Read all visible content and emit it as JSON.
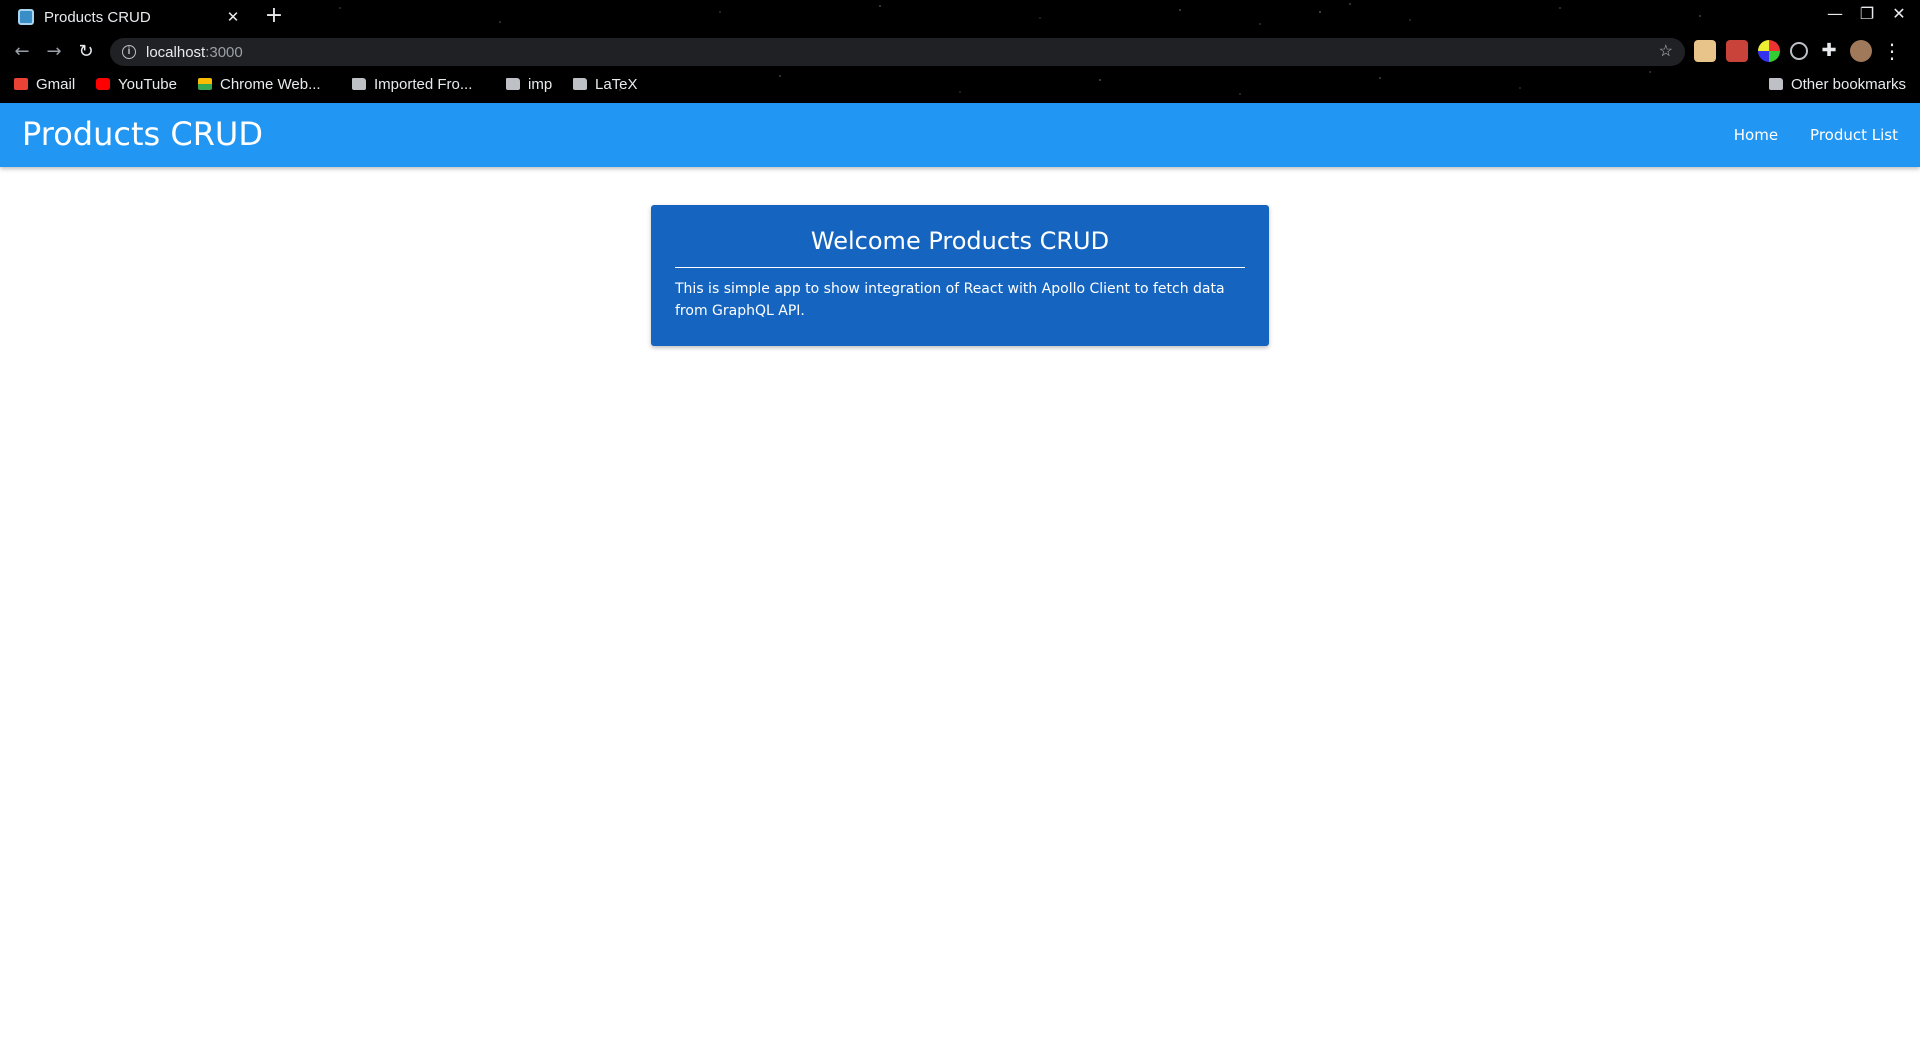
{
  "browser": {
    "tab": {
      "title": "Products CRUD",
      "close_glyph": "✕",
      "favicon": "react-icon"
    },
    "new_tab_glyph": "+",
    "window_controls": [
      "—",
      "❐",
      "✕"
    ],
    "nav": {
      "back_glyph": "←",
      "forward_glyph": "→",
      "reload_glyph": "↻"
    },
    "address": {
      "host": "localhost",
      "port": ":3000"
    },
    "bookmarks": [
      {
        "label": "Gmail",
        "icon": "gmail-icon"
      },
      {
        "label": "YouTube",
        "icon": "youtube-icon"
      },
      {
        "label": "Chrome Web...",
        "icon": "chrome-webstore-icon"
      },
      {
        "label": "Imported Fro...",
        "icon": "folder-icon"
      },
      {
        "label": "imp",
        "icon": "folder-icon"
      },
      {
        "label": "LaTeX",
        "icon": "folder-icon"
      }
    ],
    "other_bookmarks": "Other bookmarks"
  },
  "app": {
    "brand": "Products CRUD",
    "nav": {
      "home": "Home",
      "product_list": "Product List"
    },
    "welcome": {
      "title": "Welcome Products CRUD",
      "text": "This is simple app to show integration of React with Apollo Client to fetch data from GraphQL API."
    },
    "colors": {
      "app_bar": "#2196f3",
      "card": "#1565c0",
      "text": "#ffffff"
    }
  }
}
